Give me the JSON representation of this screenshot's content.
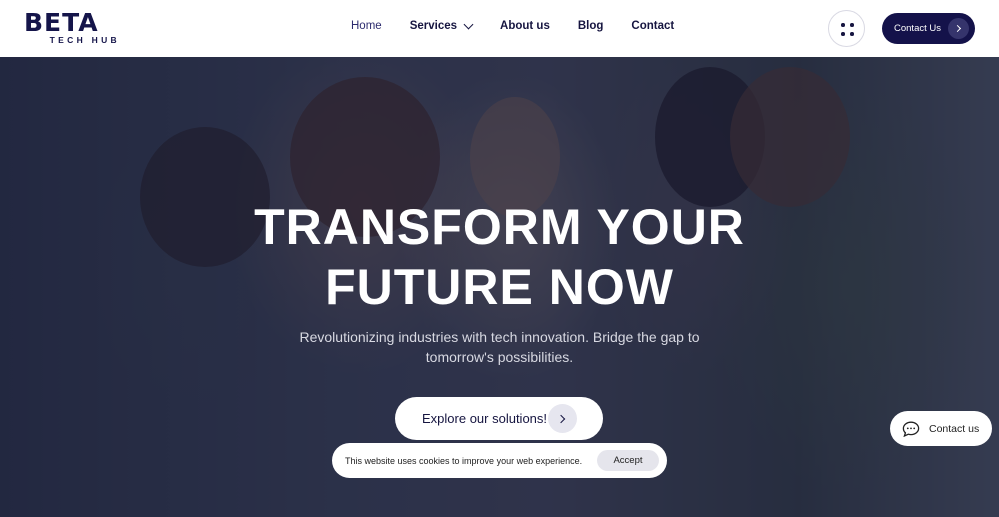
{
  "logo": {
    "main": "BETA",
    "sub": "TECH HUB"
  },
  "nav": {
    "items": [
      {
        "label": "Home"
      },
      {
        "label": "Services"
      },
      {
        "label": "About us"
      },
      {
        "label": "Blog"
      },
      {
        "label": "Contact"
      }
    ]
  },
  "header": {
    "cta_label": "Contact Us"
  },
  "hero": {
    "title_line1": "TRANSFORM YOUR",
    "title_line2": "FUTURE NOW",
    "subtitle": "Revolutionizing industries with tech innovation. Bridge the gap to tomorrow's possibilities.",
    "button_label": "Explore our solutions!"
  },
  "cookie": {
    "text": "This website uses cookies to improve your web experience.",
    "accept_label": "Accept"
  },
  "chat": {
    "label": "Contact us"
  },
  "colors": {
    "brand_navy": "#14124a",
    "text_dark": "#161540"
  },
  "icons": [
    "menu-grid-icon",
    "arrow-right-icon",
    "chevron-down-icon",
    "chat-bubble-icon"
  ]
}
